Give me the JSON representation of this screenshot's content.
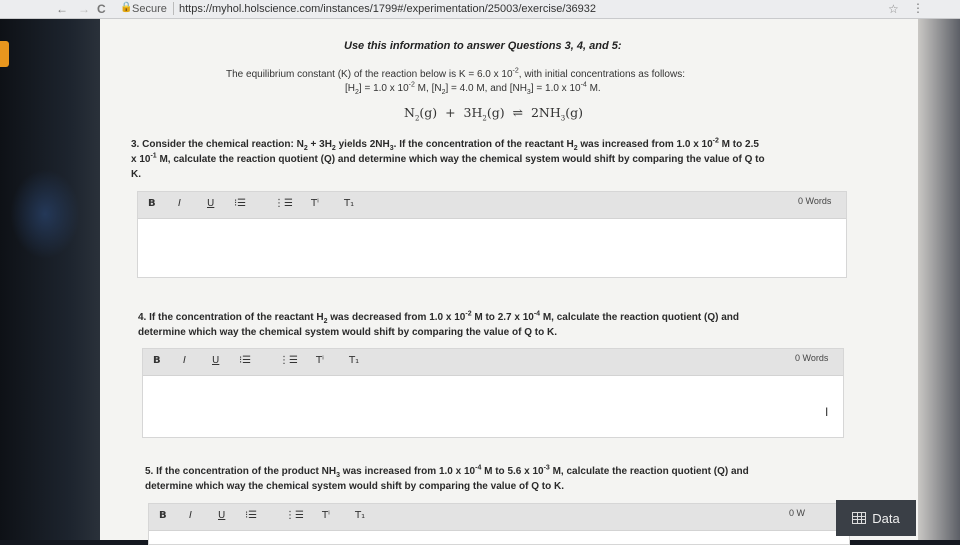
{
  "browser": {
    "back_icon": "←",
    "forward_icon": "→",
    "reload_icon": "C",
    "lock_icon": "🔒",
    "secure_label": "Secure",
    "url": "https://myhol.holscience.com/instances/1799#/experimentation/25003/exercise/36932",
    "star_icon": "☆",
    "menu_icon": "⋮"
  },
  "page": {
    "heading": "Use this information to answer Questions 3, 4, and 5:",
    "info": {
      "l1a": "The equilibrium constant (K) of the reaction below is K = 6.0 x 10",
      "l1sup": "-2",
      "l1b": ", with initial concentrations as follows:",
      "h2": "[H",
      "h2s": "2",
      "h2v": "] = 1.0 x 10",
      "h2e": "-2",
      "n2": " M, [N",
      "n2s": "2",
      "n2v": "] = 4.0 M, and [NH",
      "nh3s": "3",
      "nh3v": "] = 1.0 x 10",
      "nh3e": "-4",
      "end": " M."
    },
    "equation": {
      "a": "N",
      "as": "2",
      "b": "(g)  +  3H",
      "bs": "2",
      "c": "(g)  ⇌  2NH",
      "cs": "3",
      "d": "(g)"
    }
  },
  "q3": {
    "p1": "3. Consider the chemical reaction: N",
    "s1": "2",
    "p2": " + 3H",
    "s2": "2",
    "p3": " yields 2NH",
    "s3": "3",
    "p4": ". If the concentration of the reactant H",
    "s4": "2",
    "p5": " was increased from 1.0 x 10",
    "e1": "-2",
    "p6": " M to 2.5",
    "p7": "x 10",
    "e2": "-1",
    "p8": " M, calculate the reaction quotient (Q) and determine which way the chemical system would shift by comparing the value of Q to",
    "p9": "K.",
    "words": "0 Words"
  },
  "q4": {
    "p1": "4. If the concentration of the reactant H",
    "s1": "2",
    "p2": " was decreased from 1.0 x 10",
    "e1": "-2",
    "p3": " M to 2.7 x 10",
    "e2": "-4",
    "p4": " M, calculate the reaction quotient (Q) and",
    "p5": "determine which way the chemical system would shift by comparing the value of Q to K.",
    "words": "0 Words"
  },
  "q5": {
    "p1": "5. If the concentration of the product NH",
    "s1": "3",
    "p2": " was increased from 1.0 x 10",
    "e1": "-4",
    "p3": " M to 5.6 x 10",
    "e2": "-3",
    "p4": " M, calculate the reaction quotient (Q) and",
    "p5": "determine which way the chemical system would shift by comparing the value of Q to K.",
    "words": "0 W"
  },
  "toolbar": {
    "bold": "B",
    "italic": "I",
    "underline": "U",
    "bullet_list": "⁝☰",
    "numbered_list": "⋮☰",
    "superscript": "Tⁱ",
    "subscript": "T₁"
  },
  "cursor_icon": "I",
  "data_button": {
    "label": "Data"
  }
}
